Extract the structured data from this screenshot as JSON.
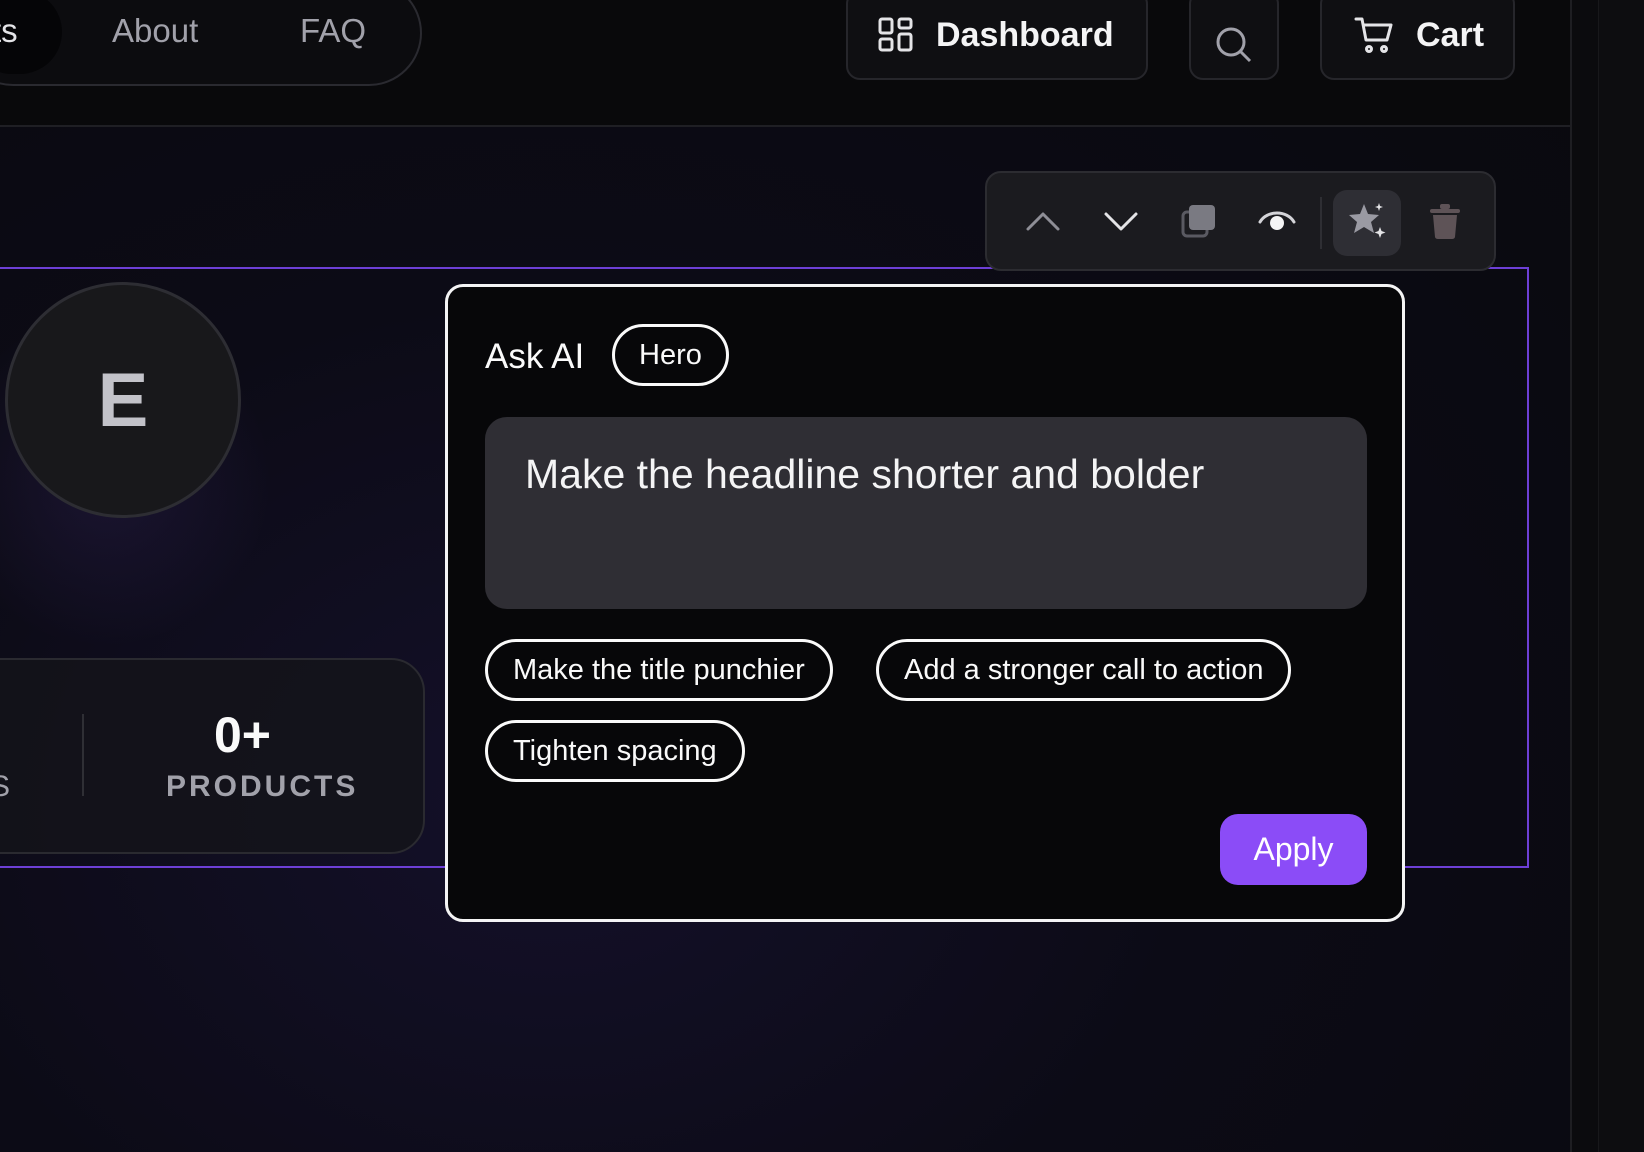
{
  "header": {
    "nav": [
      {
        "label": "ts",
        "active": true
      },
      {
        "label": "About"
      },
      {
        "label": "FAQ"
      }
    ],
    "dashboard_label": "Dashboard",
    "cart_label": "Cart"
  },
  "hero": {
    "avatar_letter": "E",
    "stats": {
      "cut_label": "S",
      "value": "0+",
      "label": "PRODUCTS"
    }
  },
  "block_toolbar": {
    "icons": [
      "chevron-up-icon",
      "chevron-down-icon",
      "duplicate-icon",
      "eye-icon",
      "sparkles-icon",
      "trash-icon"
    ]
  },
  "ai_panel": {
    "title": "Ask AI",
    "context_chip": "Hero",
    "prompt_value": "Make the headline shorter and bolder",
    "suggestions": [
      "Make the title punchier",
      "Add a stronger call to action",
      "Tighten spacing"
    ],
    "apply_label": "Apply"
  },
  "colors": {
    "accent": "#8b4cf7",
    "selection_outline": "#6d3fd6",
    "background": "#09090b"
  }
}
